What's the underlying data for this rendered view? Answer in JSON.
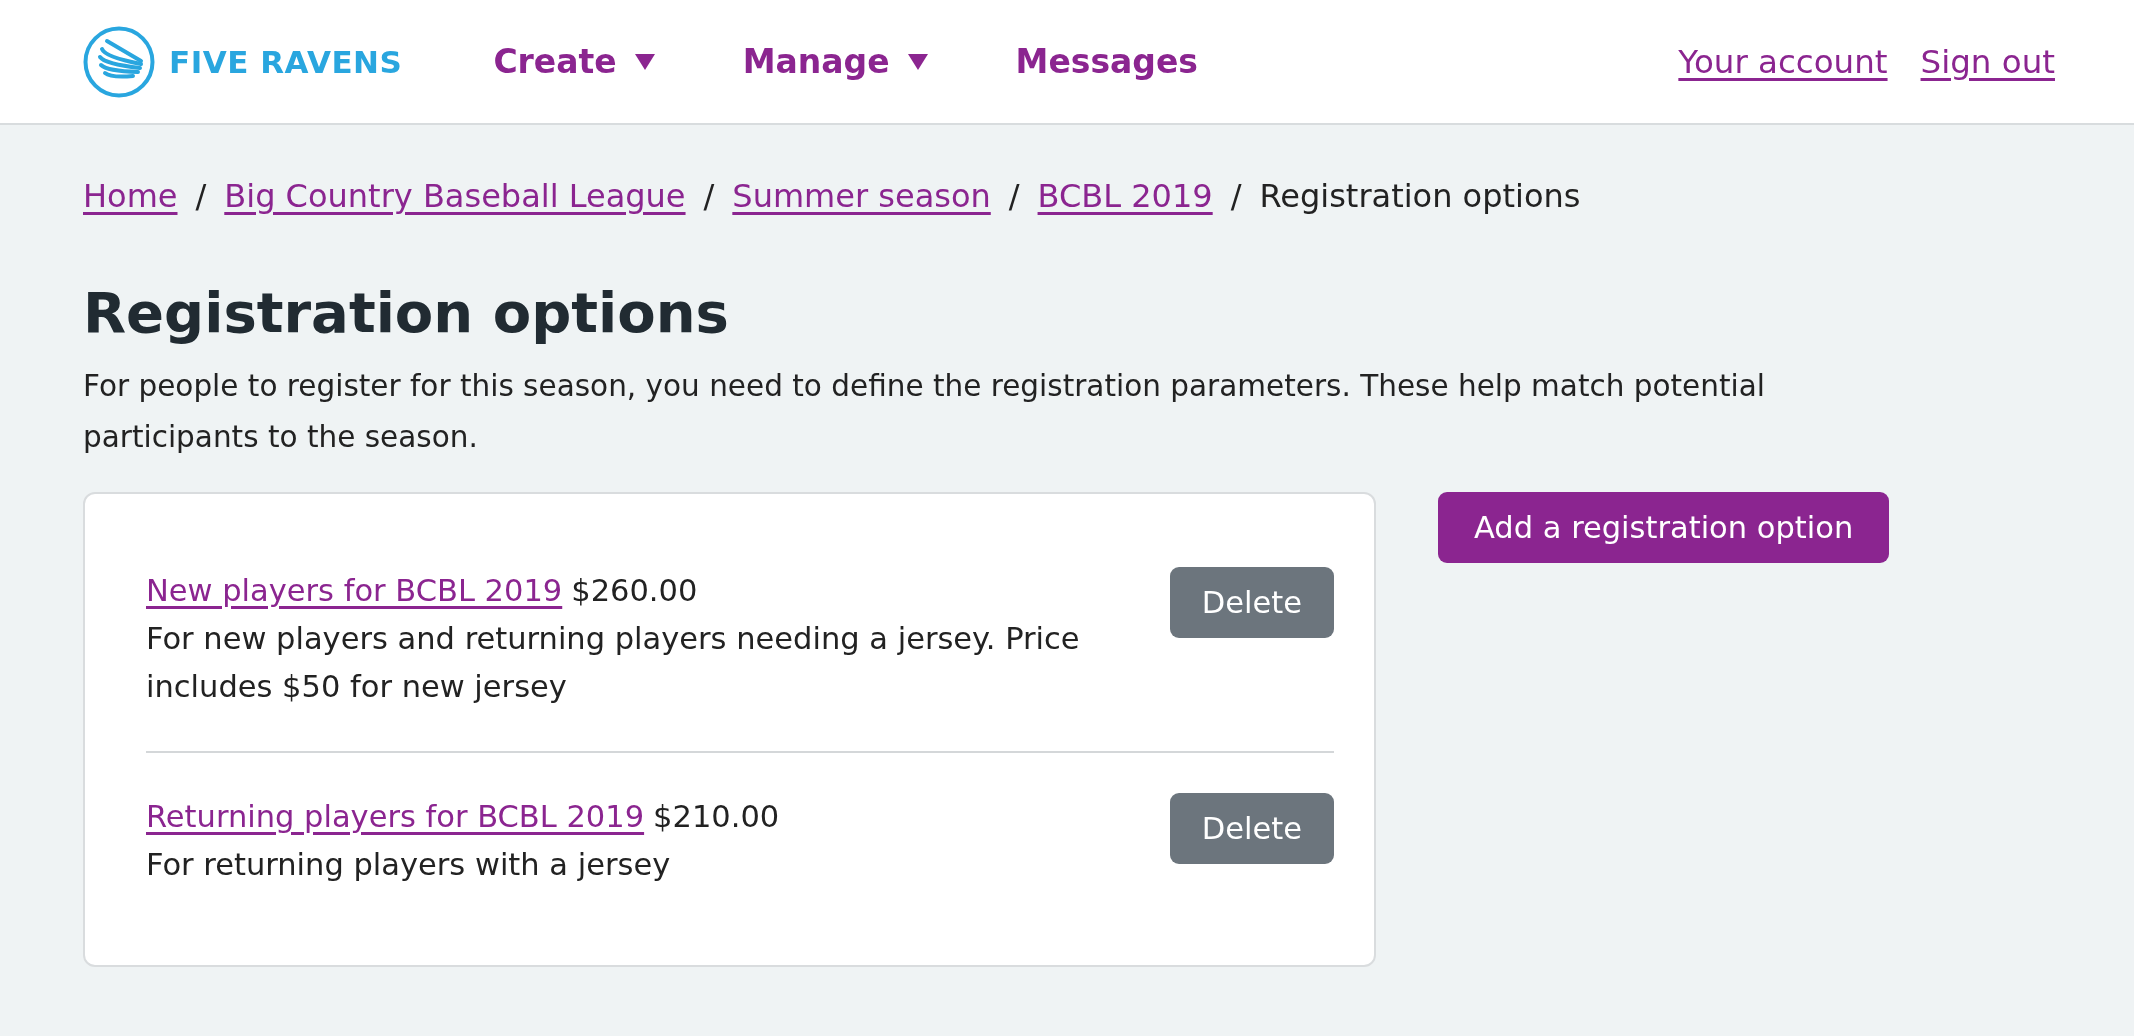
{
  "header": {
    "logo_text": "FIVE RAVENS",
    "nav": [
      {
        "label": "Create",
        "dropdown": true
      },
      {
        "label": "Manage",
        "dropdown": true
      },
      {
        "label": "Messages",
        "dropdown": false
      }
    ],
    "account_links": [
      "Your account",
      "Sign out"
    ]
  },
  "breadcrumb": [
    {
      "kind": "link",
      "label": "Home"
    },
    {
      "kind": "separator",
      "label": "/"
    },
    {
      "kind": "link",
      "label": "Big Country Baseball League"
    },
    {
      "kind": "separator",
      "label": "/"
    },
    {
      "kind": "link",
      "label": "Summer season"
    },
    {
      "kind": "separator",
      "label": "/"
    },
    {
      "kind": "link",
      "label": "BCBL 2019"
    },
    {
      "kind": "separator",
      "label": "/"
    },
    {
      "kind": "current",
      "label": "Registration options"
    }
  ],
  "page": {
    "title": "Registration options",
    "intro": "For people to register for this season, you need to define the registration parameters. These help match potential participants to the season."
  },
  "options": [
    {
      "name": "New players for BCBL 2019",
      "price": "$260.00",
      "description": "For new players and returning players needing a jersey. Price includes $50 for new jersey",
      "button": "Delete"
    },
    {
      "name": "Returning players for BCBL 2019",
      "price": "$210.00",
      "description": "For returning players with a jersey",
      "button": "Delete"
    }
  ],
  "add_button": "Add a registration option"
}
